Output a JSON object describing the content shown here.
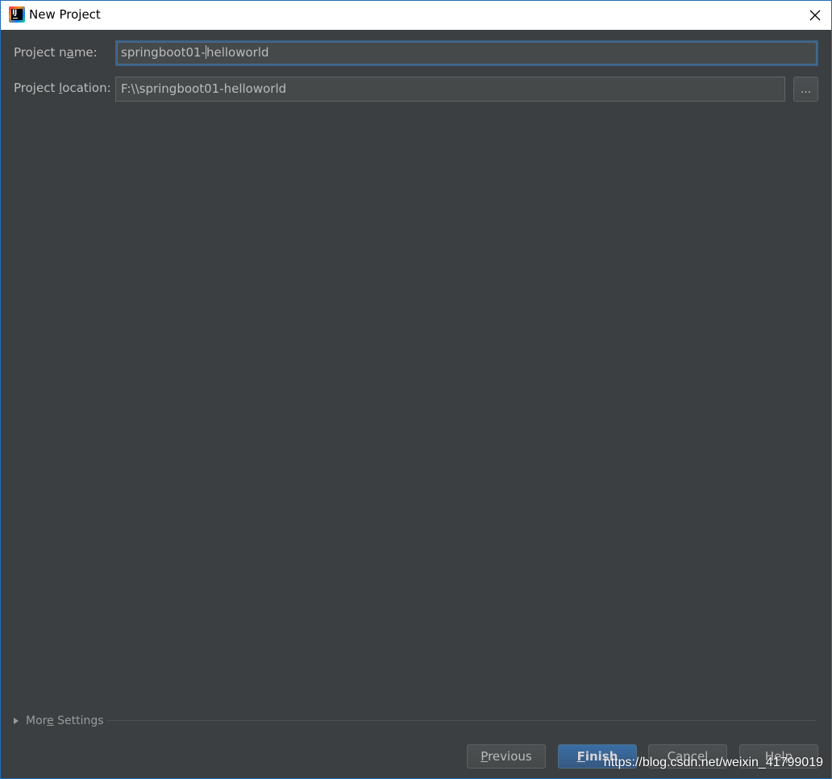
{
  "window": {
    "title": "New Project",
    "app_icon": "intellij-idea-icon",
    "close_icon": "close-icon"
  },
  "form": {
    "project_name": {
      "label_before": "Project n",
      "label_mnemonic": "a",
      "label_after": "me:",
      "value_before_caret": "springboot01-",
      "value_after_caret": "helloworld"
    },
    "project_location": {
      "label_before": "Project ",
      "label_mnemonic": "l",
      "label_after": "ocation:",
      "value": "F:\\\\springboot01-helloworld",
      "browse_label": "..."
    }
  },
  "more_settings": {
    "label_before": "Mor",
    "label_mnemonic": "e",
    "label_after": " Settings",
    "icon": "expand-triangle-icon"
  },
  "buttons": {
    "previous": {
      "mnemonic": "P",
      "rest": "revious"
    },
    "finish": {
      "mnemonic": "F",
      "rest": "inish"
    },
    "cancel": {
      "label": "Cancel"
    },
    "help": {
      "label": "Help"
    }
  },
  "watermark": "https://blog.csdn.net/weixin_41799019",
  "colors": {
    "dialog_bg": "#3c3f41",
    "field_bg": "#45494a",
    "text": "#bbbbbb",
    "focus_border": "#3d6185",
    "primary_button": "#365880"
  }
}
